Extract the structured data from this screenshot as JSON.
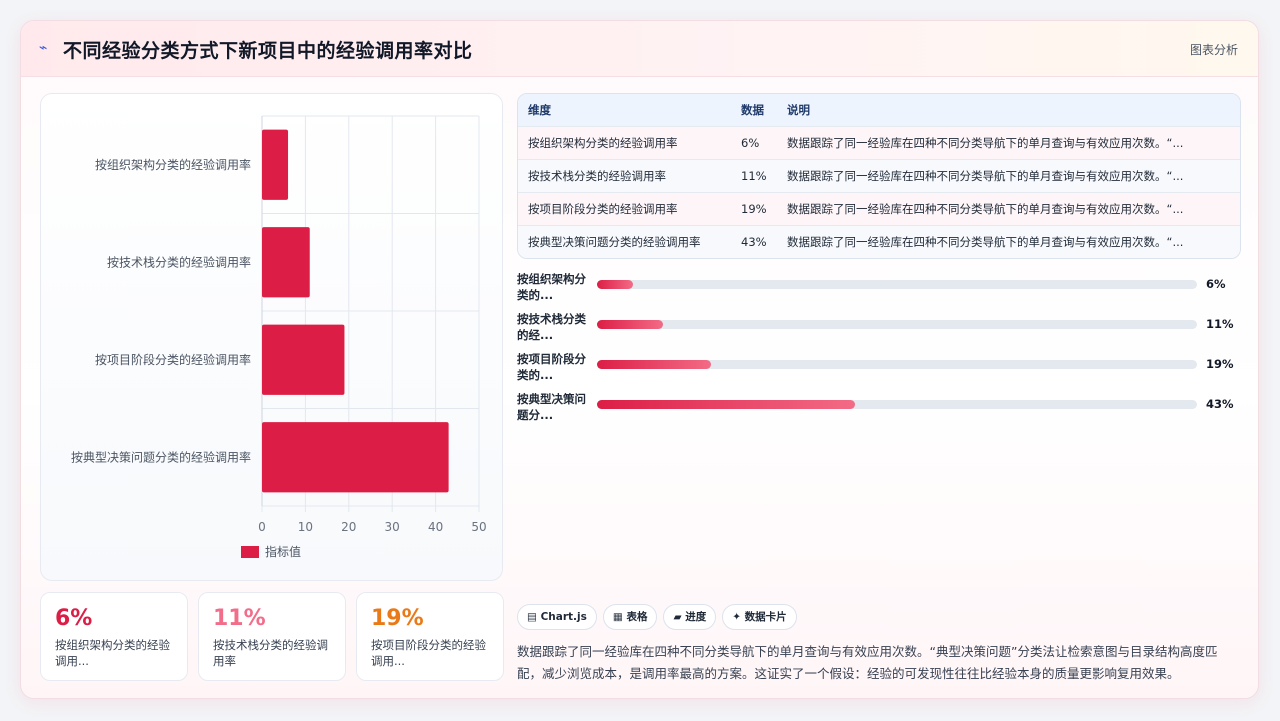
{
  "header": {
    "icon": "chart-line-icon",
    "title": "不同经验分类方式下新项目中的经验调用率对比",
    "tag": "图表分析"
  },
  "chart_data": {
    "type": "bar",
    "orientation": "horizontal",
    "categories": [
      "按组织架构分类的经验调用率",
      "按技术栈分类的经验调用率",
      "按项目阶段分类的经验调用率",
      "按典型决策问题分类的经验调用率"
    ],
    "series": [
      {
        "name": "指标值",
        "values": [
          6,
          11,
          19,
          43
        ],
        "color": "#dc1e46"
      }
    ],
    "xlim": [
      0,
      50
    ],
    "xticks": [
      "0",
      "10",
      "20",
      "30",
      "40",
      "50"
    ],
    "grid": true,
    "legend": "bottom"
  },
  "kpis": [
    {
      "value": "6%",
      "label": "按组织架构分类的经验调用...",
      "color": "#dc1e46"
    },
    {
      "value": "11%",
      "label": "按技术栈分类的经验调用率",
      "color": "#f26d8a"
    },
    {
      "value": "19%",
      "label": "按项目阶段分类的经验调用...",
      "color": "#ea7a17"
    }
  ],
  "table": {
    "headers": [
      "维度",
      "数据",
      "说明"
    ],
    "rows": [
      [
        "按组织架构分类的经验调用率",
        "6%",
        "数据跟踪了同一经验库在四种不同分类导航下的单月查询与有效应用次数。“..."
      ],
      [
        "按技术栈分类的经验调用率",
        "11%",
        "数据跟踪了同一经验库在四种不同分类导航下的单月查询与有效应用次数。“..."
      ],
      [
        "按项目阶段分类的经验调用率",
        "19%",
        "数据跟踪了同一经验库在四种不同分类导航下的单月查询与有效应用次数。“..."
      ],
      [
        "按典型决策问题分类的经验调用率",
        "43%",
        "数据跟踪了同一经验库在四种不同分类导航下的单月查询与有效应用次数。“..."
      ]
    ]
  },
  "progress": [
    {
      "label": "按组织架构分类的...",
      "value": "6%",
      "fraction": 0.06
    },
    {
      "label": "按技术栈分类的经...",
      "value": "11%",
      "fraction": 0.11
    },
    {
      "label": "按项目阶段分类的...",
      "value": "19%",
      "fraction": 0.19
    },
    {
      "label": "按典型决策问题分...",
      "value": "43%",
      "fraction": 0.43
    }
  ],
  "chips": [
    "▤ Chart.js",
    "▦ 表格",
    "▰ 进度",
    "✦ 数据卡片"
  ],
  "summary": "数据跟踪了同一经验库在四种不同分类导航下的单月查询与有效应用次数。“典型决策问题”分类法让检索意图与目录结构高度匹配，减少浏览成本，是调用率最高的方案。这证实了一个假设：经验的可发现性往往比经验本身的质量更影响复用效果。"
}
